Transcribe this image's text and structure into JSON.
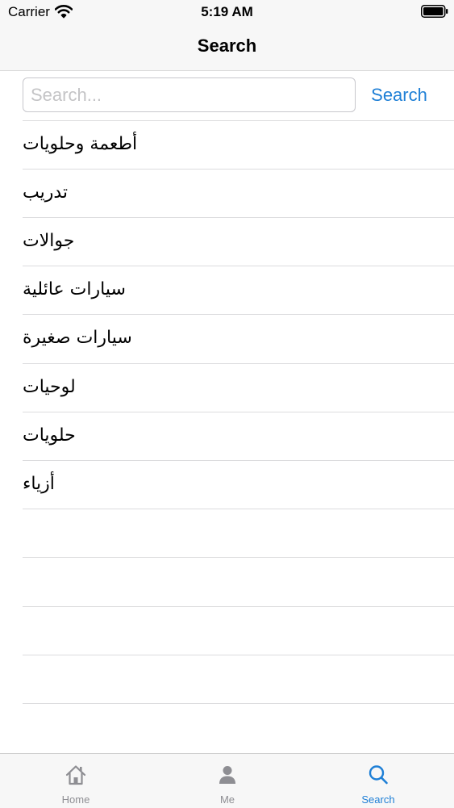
{
  "status_bar": {
    "carrier": "Carrier",
    "time": "5:19 AM",
    "wifi_icon": "wifi-icon",
    "battery_icon": "battery-icon"
  },
  "nav": {
    "title": "Search"
  },
  "search": {
    "placeholder": "Search...",
    "value": "",
    "button_label": "Search"
  },
  "categories": [
    "أطعمة وحلويات",
    "تدريب",
    "جوالات",
    "سيارات عائلية",
    "سيارات صغيرة",
    "لوحيات",
    "حلويات",
    "أزياء"
  ],
  "tab_bar": {
    "active": "search",
    "active_color": "#1e7fd6",
    "inactive_color": "#8e8e93",
    "tabs": [
      {
        "id": "home",
        "label": "Home",
        "icon": "home-icon"
      },
      {
        "id": "me",
        "label": "Me",
        "icon": "person-icon"
      },
      {
        "id": "search",
        "label": "Search",
        "icon": "search-icon"
      }
    ]
  }
}
